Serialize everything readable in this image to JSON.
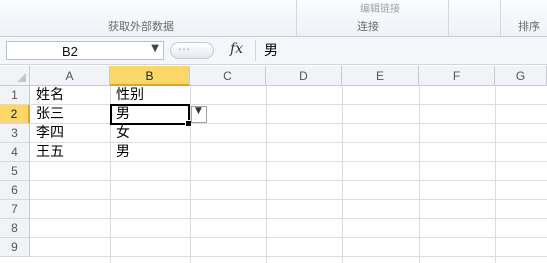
{
  "ribbon": {
    "group_get_external_data": "获取外部数据",
    "group_connections": "连接",
    "group_sort_filter": "排序",
    "edit_links_ghost": "编辑链接"
  },
  "formula_bar": {
    "name_box": "B2",
    "fx_label": "fx",
    "value": "男"
  },
  "columns": [
    "A",
    "B",
    "C",
    "D",
    "E",
    "F",
    "G"
  ],
  "rows": [
    "1",
    "2",
    "3",
    "4",
    "5",
    "6",
    "7",
    "8",
    "9"
  ],
  "cells": {
    "A1": "姓名",
    "B1": "性别",
    "A2": "张三",
    "B2": "男",
    "A3": "李四",
    "B3": "女",
    "A4": "王五",
    "B4": "男"
  },
  "selection": {
    "active_cell": "B2",
    "column": "B",
    "row": "2"
  }
}
